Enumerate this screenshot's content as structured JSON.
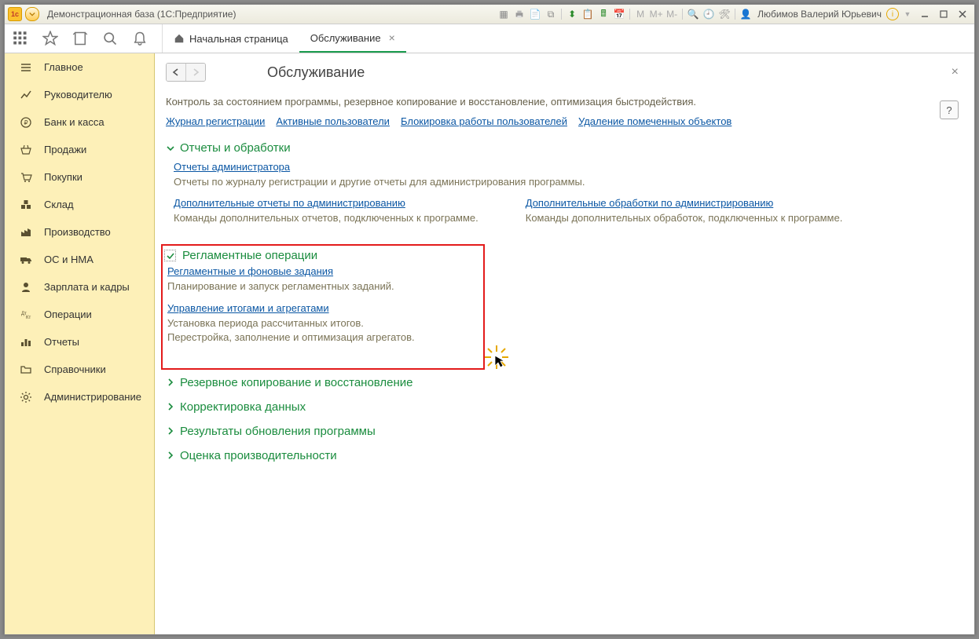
{
  "titlebar": {
    "app_title": "Демонстрационная база  (1С:Предприятие)",
    "user": "Любимов Валерий Юрьевич"
  },
  "tabs": {
    "home": "Начальная страница",
    "active": "Обслуживание"
  },
  "sidebar": [
    {
      "id": "main",
      "label": "Главное"
    },
    {
      "id": "manager",
      "label": "Руководителю"
    },
    {
      "id": "bank",
      "label": "Банк и касса"
    },
    {
      "id": "sales",
      "label": "Продажи"
    },
    {
      "id": "purchases",
      "label": "Покупки"
    },
    {
      "id": "warehouse",
      "label": "Склад"
    },
    {
      "id": "production",
      "label": "Производство"
    },
    {
      "id": "assets",
      "label": "ОС и НМА"
    },
    {
      "id": "payroll",
      "label": "Зарплата и кадры"
    },
    {
      "id": "operations",
      "label": "Операции"
    },
    {
      "id": "reports",
      "label": "Отчеты"
    },
    {
      "id": "reference",
      "label": "Справочники"
    },
    {
      "id": "admin",
      "label": "Администрирование"
    }
  ],
  "page": {
    "title": "Обслуживание",
    "description": "Контроль за состоянием программы, резервное копирование и восстановление, оптимизация быстродействия.",
    "help": "?",
    "top_links": [
      "Журнал регистрации",
      "Активные пользователи",
      "Блокировка работы пользователей",
      "Удаление помеченных объектов"
    ],
    "sections": {
      "reports": {
        "title": "Отчеты и обработки",
        "item1": {
          "link": "Отчеты администратора",
          "desc": "Отчеты по журналу регистрации и другие отчеты для администрирования программы."
        },
        "item2": {
          "link": "Дополнительные отчеты по администрированию",
          "desc": "Команды дополнительных отчетов, подключенных к программе."
        },
        "item3": {
          "link": "Дополнительные обработки по администрированию",
          "desc": "Команды дополнительных обработок, подключенных к программе."
        }
      },
      "scheduled": {
        "title": "Регламентные операции",
        "item1": {
          "link": "Регламентные и фоновые задания",
          "desc": "Планирование и запуск регламентных заданий."
        },
        "item2": {
          "link": "Управление итогами и агрегатами",
          "desc": "Установка периода рассчитанных итогов.\nПерестройка, заполнение и оптимизация агрегатов."
        }
      },
      "backup": {
        "title": "Резервное копирование и восстановление"
      },
      "correction": {
        "title": "Корректировка данных"
      },
      "update": {
        "title": "Результаты обновления программы"
      },
      "perf": {
        "title": "Оценка производительности"
      }
    }
  }
}
